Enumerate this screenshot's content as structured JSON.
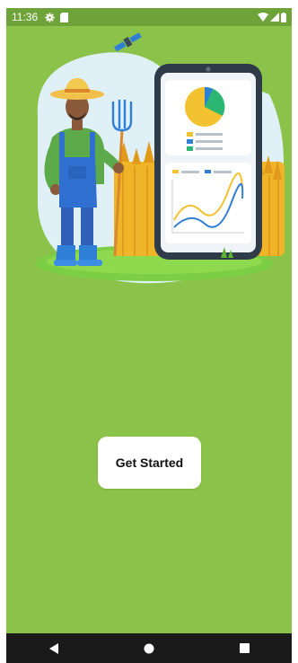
{
  "status_bar": {
    "time": "11:36",
    "left_icons": [
      "gear-icon",
      "sim-card-icon"
    ],
    "right_icons": [
      "wifi-icon",
      "cellular-signal-icon",
      "battery-icon"
    ],
    "background": "#6ea33a"
  },
  "screen": {
    "background": "#8bc34a"
  },
  "hero": {
    "illustration": "farmer-with-pitchfork-and-phone-charts",
    "legend_colors": [
      "#f2c230",
      "#2f7fd6",
      "#2bb673"
    ]
  },
  "main": {
    "get_started_label": "Get Started"
  },
  "nav_bar": {
    "background": "#1a1a1a",
    "items": [
      "back-icon",
      "home-icon",
      "recents-icon"
    ]
  }
}
